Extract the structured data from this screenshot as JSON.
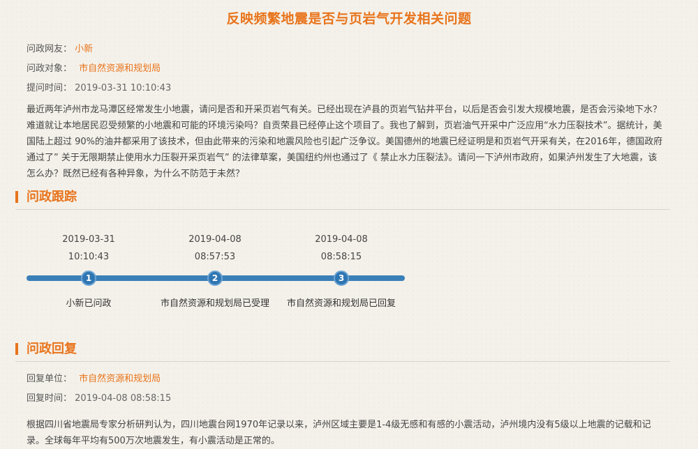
{
  "title": "反映频繁地震是否与页岩气开发相关问题",
  "question": {
    "user_label": "问政网友：",
    "user_value": "小新",
    "target_label": "问政对象：",
    "target_value": "市自然资源和规划局",
    "time_label": "提问时间：",
    "time_value": "2019-03-31 10:10:43",
    "content": "最近两年泸州市龙马潭区经常发生小地震，请问是否和开采页岩气有关。已经出现在泸县的页岩气钻井平台，以后是否会引发大规模地震，是否会污染地下水？难道就让本地居民忍受频繁的小地震和可能的环境污染吗？自贡荣县已经停止这个项目了。我也了解到，页岩油气开采中广泛应用“水力压裂技术”。据统计，美国陆上超过 90%的油井都采用了该技术，但由此带来的污染和地震风险也引起广泛争议。美国德州的地震已经证明是和页岩气开采有关，在2016年，德国政府通过了” 关于无限期禁止使用水力压裂开采页岩气” 的法律草案，美国纽约州也通过了《 禁止水力压裂法》。请问一下泸州市政府，如果泸州发生了大地震，该怎么办？既然已经有各种异象，为什么不防范于未然？"
  },
  "tracking": {
    "heading": "问政跟踪",
    "steps": [
      {
        "num": "1",
        "date": "2019-03-31",
        "time": "10:10:43",
        "label": "小新已问政"
      },
      {
        "num": "2",
        "date": "2019-04-08",
        "time": "08:57:53",
        "label": "市自然资源和规划局已受理"
      },
      {
        "num": "3",
        "date": "2019-04-08",
        "time": "08:58:15",
        "label": "市自然资源和规划局已回复"
      }
    ]
  },
  "reply": {
    "heading": "问政回复",
    "unit_label": "回复单位：",
    "unit_value": "市自然资源和规划局",
    "time_label": "回复时间：",
    "time_value": "2019-04-08 08:58:15",
    "content": "根据四川省地震局专家分析研判认为，四川地震台网1970年记录以来，泸州区域主要是1-4级无感和有感的小震活动，泸州境内没有5级以上地震的记载和记录。全球每年平均有500万次地震发生，有小震活动是正常的。"
  },
  "colors": {
    "accent": "#e8741c",
    "timeline": "#2f76b2"
  }
}
